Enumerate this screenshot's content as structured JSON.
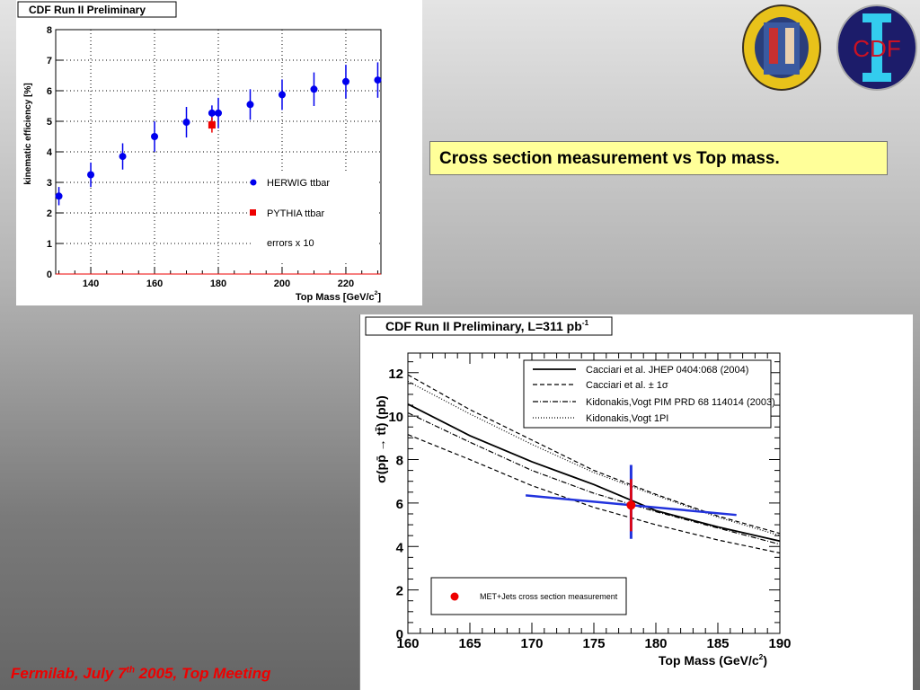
{
  "caption": "Cross section measurement vs Top mass.",
  "footer": {
    "prefix": "Fermilab, July 7",
    "sup": "th",
    "suffix": " 2005,  Top  Meeting"
  },
  "logos": {
    "padova": "UNIVERSITAS STUDII PATAVINI",
    "cdf": "CDF"
  },
  "colors": {
    "herwig": "#0000ee",
    "pythia": "#ee0000",
    "caption_bg": "#ffff99",
    "footer": "#ee0000"
  },
  "chart_data": [
    {
      "type": "scatter",
      "title": "CDF Run II Preliminary",
      "xlabel": "Top Mass [GeV/c",
      "xlabel_sup": "2",
      "xlabel_end": "]",
      "ylabel": "kinematic efficiency [%]",
      "xlim": [
        129,
        231
      ],
      "ylim": [
        0,
        8
      ],
      "xticks": [
        140,
        160,
        180,
        200,
        220
      ],
      "yticks": [
        0,
        1,
        2,
        3,
        4,
        5,
        6,
        7,
        8
      ],
      "grid": true,
      "legend_position": "bottom-right",
      "note": "errors x 10",
      "series": [
        {
          "name": "HERWIG ttbar",
          "marker": "circle",
          "x": [
            130,
            140,
            150,
            160,
            170,
            178,
            180,
            190,
            200,
            210,
            220,
            230
          ],
          "y": [
            2.55,
            3.25,
            3.85,
            4.5,
            4.97,
            5.27,
            5.27,
            5.55,
            5.87,
            6.05,
            6.3,
            6.35
          ],
          "err": [
            0.3,
            0.4,
            0.43,
            0.5,
            0.5,
            0.25,
            0.5,
            0.5,
            0.5,
            0.55,
            0.55,
            0.58
          ]
        },
        {
          "name": "PYTHIA ttbar",
          "marker": "square",
          "x": [
            178
          ],
          "y": [
            4.88
          ],
          "err": [
            0.25
          ]
        }
      ]
    },
    {
      "type": "line",
      "title": "CDF Run II Preliminary, L=311 pb",
      "title_sup": "-1",
      "xlabel": "Top Mass (GeV/c",
      "xlabel_sup": "2",
      "xlabel_end": ")",
      "ylabel": "σ(pp̄ → tt̄) (pb)",
      "xlim": [
        160,
        190
      ],
      "ylim": [
        0,
        12.9
      ],
      "xticks": [
        160,
        165,
        170,
        175,
        180,
        185,
        190
      ],
      "yticks": [
        0,
        2,
        4,
        6,
        8,
        10,
        12
      ],
      "grid": false,
      "legend_position": "top-right",
      "x": [
        160,
        165,
        170,
        175,
        180,
        185,
        190
      ],
      "series": [
        {
          "name": "Cacciari et al. JHEP 0404:068 (2004)",
          "style": "solid",
          "y": [
            10.55,
            9.1,
            7.9,
            6.85,
            5.65,
            4.9,
            4.25
          ]
        },
        {
          "name": "Cacciari et al. ± 1σ",
          "style": "dashed",
          "y": [
            11.9,
            10.3,
            8.9,
            7.5,
            6.4,
            5.4,
            4.6
          ]
        },
        {
          "name": "",
          "style": "dashed",
          "y": [
            9.15,
            8.0,
            6.8,
            5.8,
            5.0,
            4.3,
            3.7
          ]
        },
        {
          "name": "Kidonakis,Vogt PIM PRD 68 114014 (2003)",
          "style": "dashdot",
          "y": [
            10.15,
            8.8,
            7.5,
            6.45,
            5.6,
            4.85,
            4.1
          ]
        },
        {
          "name": "Kidonakis,Vogt 1PI",
          "style": "dotted",
          "y": [
            11.6,
            10.1,
            8.7,
            7.4,
            6.35,
            5.35,
            4.5
          ]
        }
      ],
      "mass_dependence_line": {
        "x": [
          169.5,
          186.5
        ],
        "y": [
          6.35,
          5.45
        ]
      },
      "measurement": {
        "name": "MET+Jets cross section measurement",
        "x": 178,
        "y": 5.9,
        "stat_err": [
          4.7,
          7.1
        ],
        "total_err": [
          4.35,
          7.75
        ]
      }
    }
  ]
}
